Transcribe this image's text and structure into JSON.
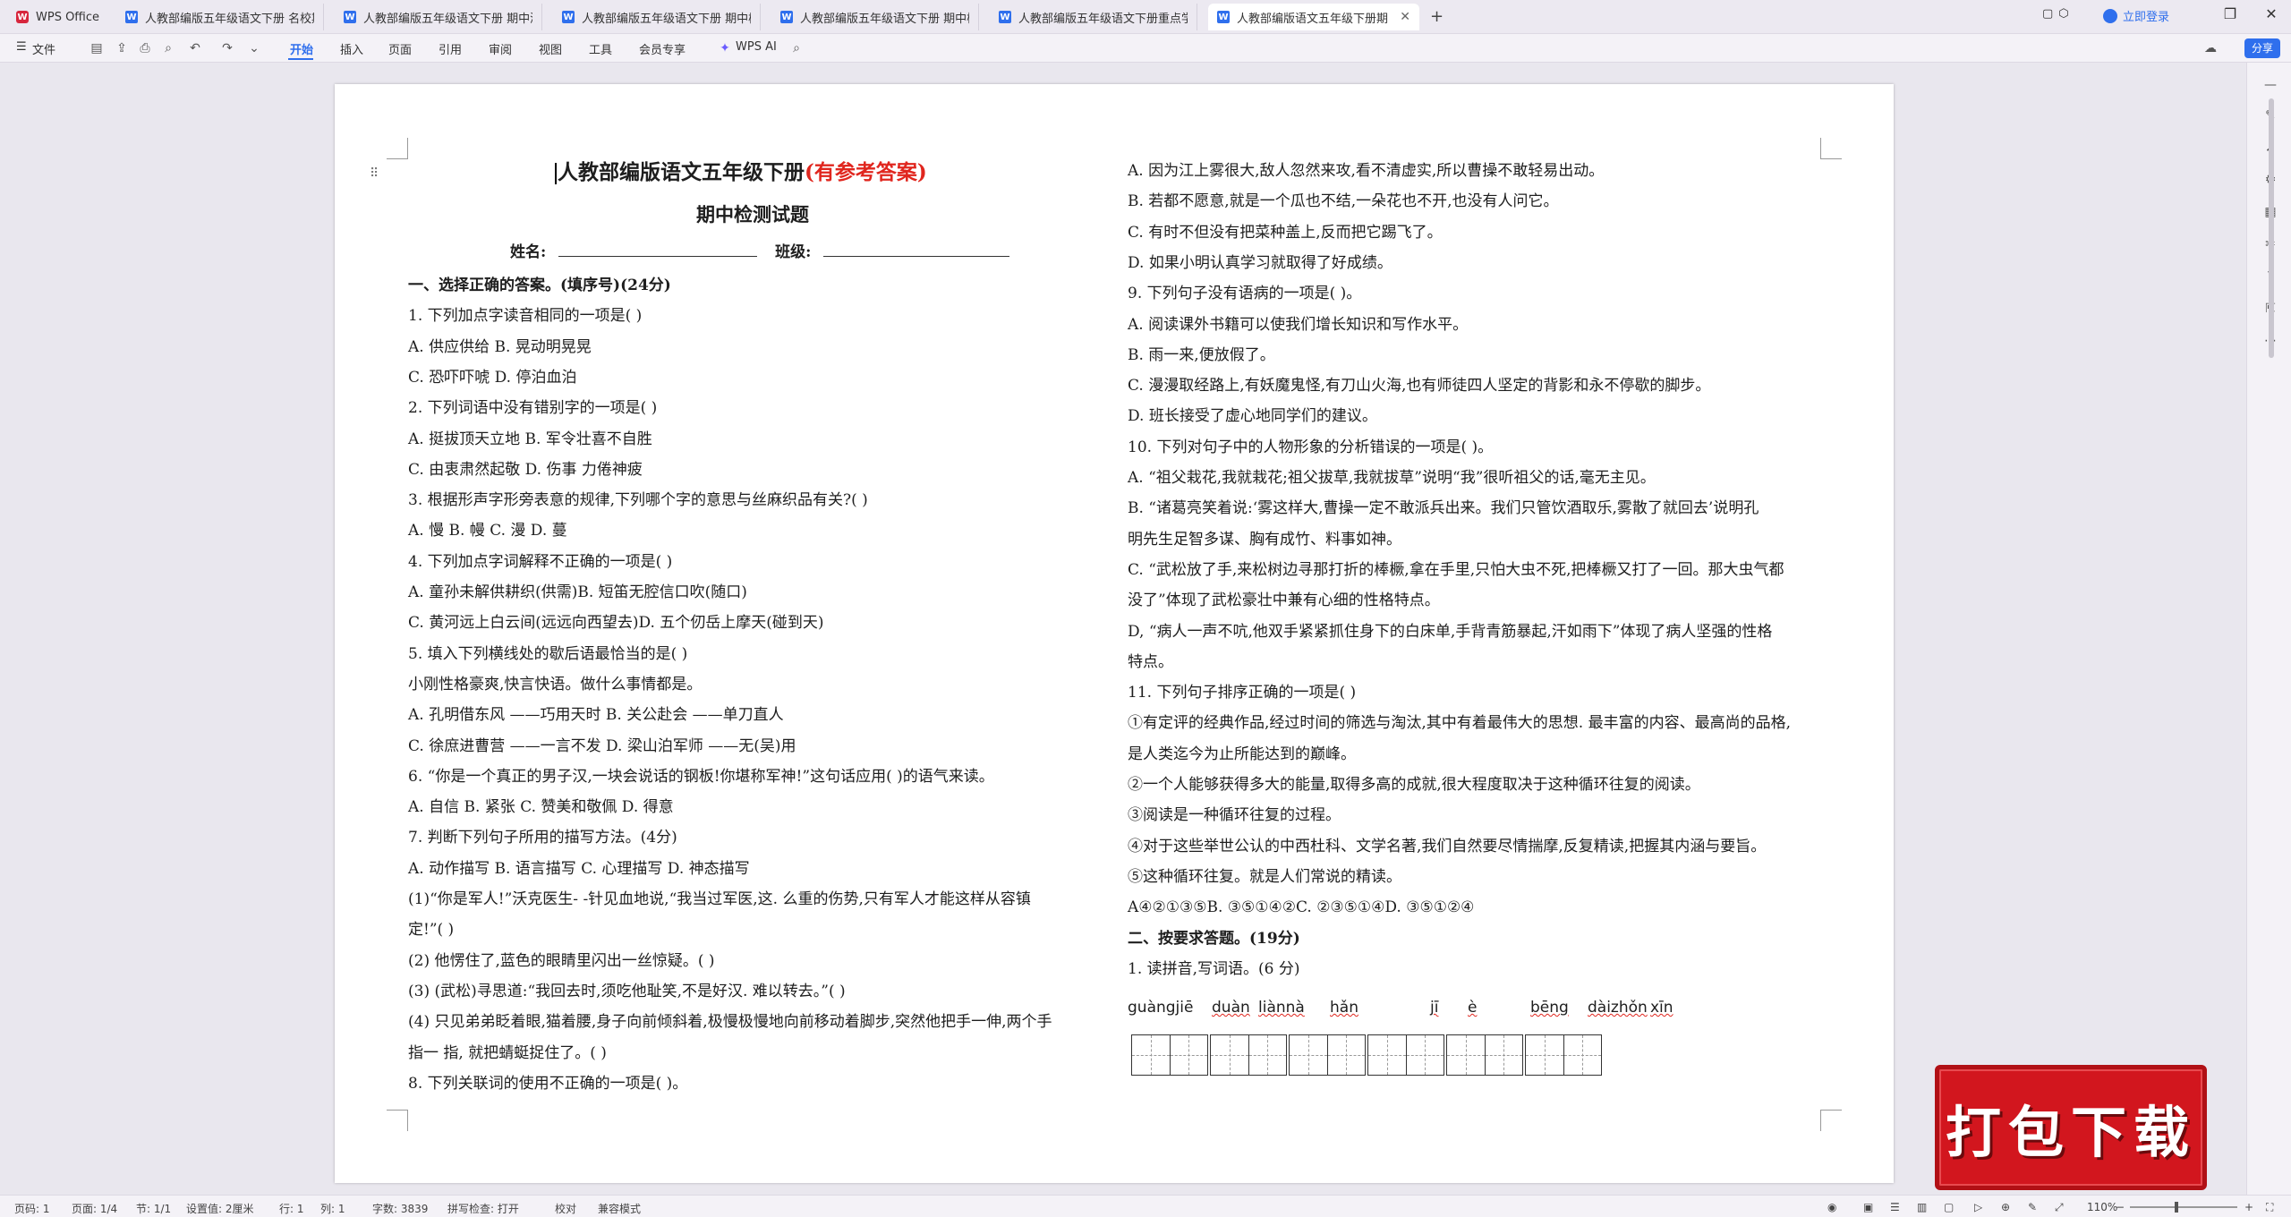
{
  "titlebar": {
    "app_name": "WPS Office",
    "tabs": [
      "人教部编版五年级语文下册 名校期中",
      "人教部编版五年级语文下册 期中测评",
      "人教部编版五年级语文下册 期中模拟",
      "人教部编版五年级语文下册 期中检测",
      "人教部编版五年级语文下册重点学校",
      "人教部编版语文五年级下册期"
    ],
    "login_label": "立即登录"
  },
  "ribbon": {
    "file_label": "文件",
    "tabs": [
      "开始",
      "插入",
      "页面",
      "引用",
      "审阅",
      "视图",
      "工具",
      "会员专享"
    ],
    "wps_ai_label": "WPS AI",
    "share_label": "分享"
  },
  "document": {
    "title_main": "人教部编版语文五年级下册",
    "title_suffix": "(有参考答案)",
    "subtitle": "期中检测试题",
    "name_label": "姓名:",
    "class_label": "班级:",
    "left_lines": [
      {
        "t": "一、选择正确的答案。(填序号)(24分)",
        "b": true
      },
      {
        "t": "1. 下列加点字读音相同的一项是( )"
      },
      {
        "t": "A. 供应供给  B. 晃动明晃晃"
      },
      {
        "t": "C. 恐吓吓唬           D. 停泊血泊"
      },
      {
        "t": "2. 下列词语中没有错别字的一项是( )"
      },
      {
        "t": "A. 挺拔顶天立地  B. 军令壮喜不自胜"
      },
      {
        "t": "C. 由衷肃然起敬  D. 伤事  力倦神疲"
      },
      {
        "t": "3. 根据形声字形旁表意的规律,下列哪个字的意思与丝麻织品有关?( )"
      },
      {
        "t": "A. 慢  B. 幔  C. 漫  D. 蔓"
      },
      {
        "t": "4. 下列加点字词解释不正确的一项是( )"
      },
      {
        "t": "A. 童孙未解供耕织(供需)B. 短笛无腔信口吹(随口)"
      },
      {
        "t": "C. 黄河远上白云间(远远向西望去)D. 五个仞岳上摩天(碰到天)"
      },
      {
        "t": "5. 填入下列横线处的歇后语最恰当的是( )"
      },
      {
        "t": "小刚性格豪爽,快言快语。做什么事情都是。"
      },
      {
        "t": "A. 孔明借东风  ——巧用天时 B. 关公赴会  ——单刀直人"
      },
      {
        "t": "C. 徐庶进曹营  ——一言不发 D. 梁山泊军师  ——无(吴)用"
      },
      {
        "t": "6. “你是一个真正的男子汉,一块会说话的钢板!你堪称军神!”这句话应用( )的语气来读。"
      },
      {
        "t": "A.  自信       B. 紧张  C. 赞美和敬佩  D. 得意"
      },
      {
        "t": "7. 判断下列句子所用的描写方法。(4分)"
      },
      {
        "t": "A. 动作描写 B.  语言描写 C.  心理描写 D.  神态描写"
      },
      {
        "t": "(1)“你是军人!”沃克医生- -针见血地说,“我当过军医,这. 么重的伤势,只有军人才能这样从容镇"
      },
      {
        "t": "定!”( )"
      },
      {
        "t": "(2) 他愣住了,蓝色的眼睛里闪出一丝惊疑。( )"
      },
      {
        "t": "(3) (武松)寻思道:“我回去时,须吃他耻笑,不是好汉. 难以转去。”( )"
      },
      {
        "t": "(4) 只见弟弟眨着眼,猫着腰,身子向前倾斜着,极慢极慢地向前移动着脚步,突然他把手一伸,两个手"
      },
      {
        "t": "指一  指,  就把蜻蜓捉住了。( )"
      },
      {
        "t": "8. 下列关联词的使用不正确的一项是( )。"
      }
    ],
    "right_lines": [
      {
        "t": "A. 因为江上雾很大,敌人忽然来攻,看不清虚实,所以曹操不敢轻易出动。"
      },
      {
        "t": "B. 若都不愿意,就是一个瓜也不结,一朵花也不开,也没有人问它。"
      },
      {
        "t": "C. 有时不但没有把菜种盖上,反而把它踢飞了。"
      },
      {
        "t": "D. 如果小明认真学习就取得了好成绩。"
      },
      {
        "t": "9. 下列句子没有语病的一项是( )。"
      },
      {
        "t": "A. 阅读课外书籍可以使我们增长知识和写作水平。"
      },
      {
        "t": "B. 雨一来,便放假了。"
      },
      {
        "t": "C. 漫漫取经路上,有妖魔鬼怪,有刀山火海,也有师徒四人坚定的背影和永不停歇的脚步。"
      },
      {
        "t": "D. 班长接受了虚心地同学们的建议。"
      },
      {
        "t": "10. 下列对句子中的人物形象的分析错误的一项是( )。"
      },
      {
        "t": "A. “祖父栽花,我就栽花;祖父拔草,我就拔草”说明“我”很听祖父的话,毫无主见。"
      },
      {
        "t": "B. “诸葛亮笑着说:‘雾这样大,曹操一定不敢派兵出来。我们只管饮酒取乐,雾散了就回去’说明孔"
      },
      {
        "t": "明先生足智多谋、胸有成竹、料事如神。"
      },
      {
        "t": "C. “武松放了手,来松树边寻那打折的棒橛,拿在手里,只怕大虫不死,把棒橛又打了一回。那大虫气都"
      },
      {
        "t": "没了”体现了武松豪壮中兼有心细的性格特点。"
      },
      {
        "t": "D, “病人一声不吭,他双手紧紧抓住身下的白床单,手背青筋暴起,汗如雨下”体现了病人坚强的性格"
      },
      {
        "t": "特点。"
      },
      {
        "t": "11. 下列句子排序正确的一项是( )"
      },
      {
        "t": "①有定评的经典作品,经过时间的筛选与淘汰,其中有着最伟大的思想. 最丰富的内容、最高尚的品格,"
      },
      {
        "t": "是人类迄今为止所能达到的巅峰。"
      },
      {
        "t": "②一个人能够获得多大的能量,取得多高的成就,很大程度取决于这种循环往复的阅读。"
      },
      {
        "t": "③阅读是一种循环往复的过程。"
      },
      {
        "t": "④对于这些举世公认的中西杜科、文学名著,我们自然要尽情揣摩,反复精读,把握其内涵与要旨。"
      },
      {
        "t": "⑤这种循环往复。就是人们常说的精读。"
      },
      {
        "t": "A④②①③⑤B. ③⑤①④②C. ②③⑤①④D. ③⑤①②④"
      },
      {
        "t": "二、按要求答题。(19分)",
        "b": true
      },
      {
        "t": "1. 读拼音,写词语。(6 分)"
      }
    ],
    "pinyin": [
      "guàngjiē",
      "duàn",
      "liànnà",
      "hǎn",
      "jī",
      "è",
      "bēng",
      "dàizhǒn",
      "xīn"
    ]
  },
  "promo": {
    "label": "打包下载"
  },
  "statusbar": {
    "page_code": "页码: 1",
    "page_count": "页面: 1/4",
    "section": "节: 1/1",
    "setting": "设置值: 2厘米",
    "row": "行: 1",
    "column": "列: 1",
    "word_count": "字数: 3839",
    "spell_check": "拼写检查: 打开",
    "proofread": "校对",
    "compat_mode": "兼容模式",
    "zoom": "110%"
  },
  "colors": {
    "accent": "#2f6fed",
    "title_red": "#e0261e",
    "promo_red": "#d2161e"
  }
}
